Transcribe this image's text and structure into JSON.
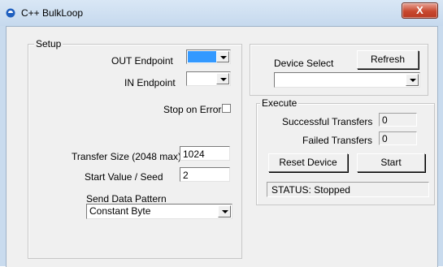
{
  "window": {
    "title": "C++ BulkLoop",
    "close_label": "X"
  },
  "setup": {
    "group_label": "Setup",
    "out_endpoint_label": "OUT Endpoint",
    "out_endpoint_value": "",
    "in_endpoint_label": "IN Endpoint",
    "in_endpoint_value": "",
    "stop_on_error_label": "Stop on Error",
    "stop_on_error_checked": false,
    "transfer_size_label": "Transfer Size (2048 max)",
    "transfer_size_value": "1024",
    "start_value_label": "Start Value / Seed",
    "start_value_value": "2",
    "pattern_label": "Send Data Pattern",
    "pattern_value": "Constant Byte"
  },
  "device": {
    "select_label": "Device Select",
    "refresh_label": "Refresh",
    "device_value": ""
  },
  "execute": {
    "group_label": "Execute",
    "successful_label": "Successful Transfers",
    "successful_value": "0",
    "failed_label": "Failed Transfers",
    "failed_value": "0",
    "reset_label": "Reset Device",
    "start_label": "Start",
    "status_text": "STATUS: Stopped"
  },
  "colors": {
    "title_bar": "#c9dbee",
    "close_button": "#c8482f",
    "selection": "#3399ff",
    "dialog_face": "#f0f0f0"
  },
  "icons": {
    "app": "app-icon",
    "close": "close-icon",
    "dropdown": "chevron-down-icon"
  }
}
